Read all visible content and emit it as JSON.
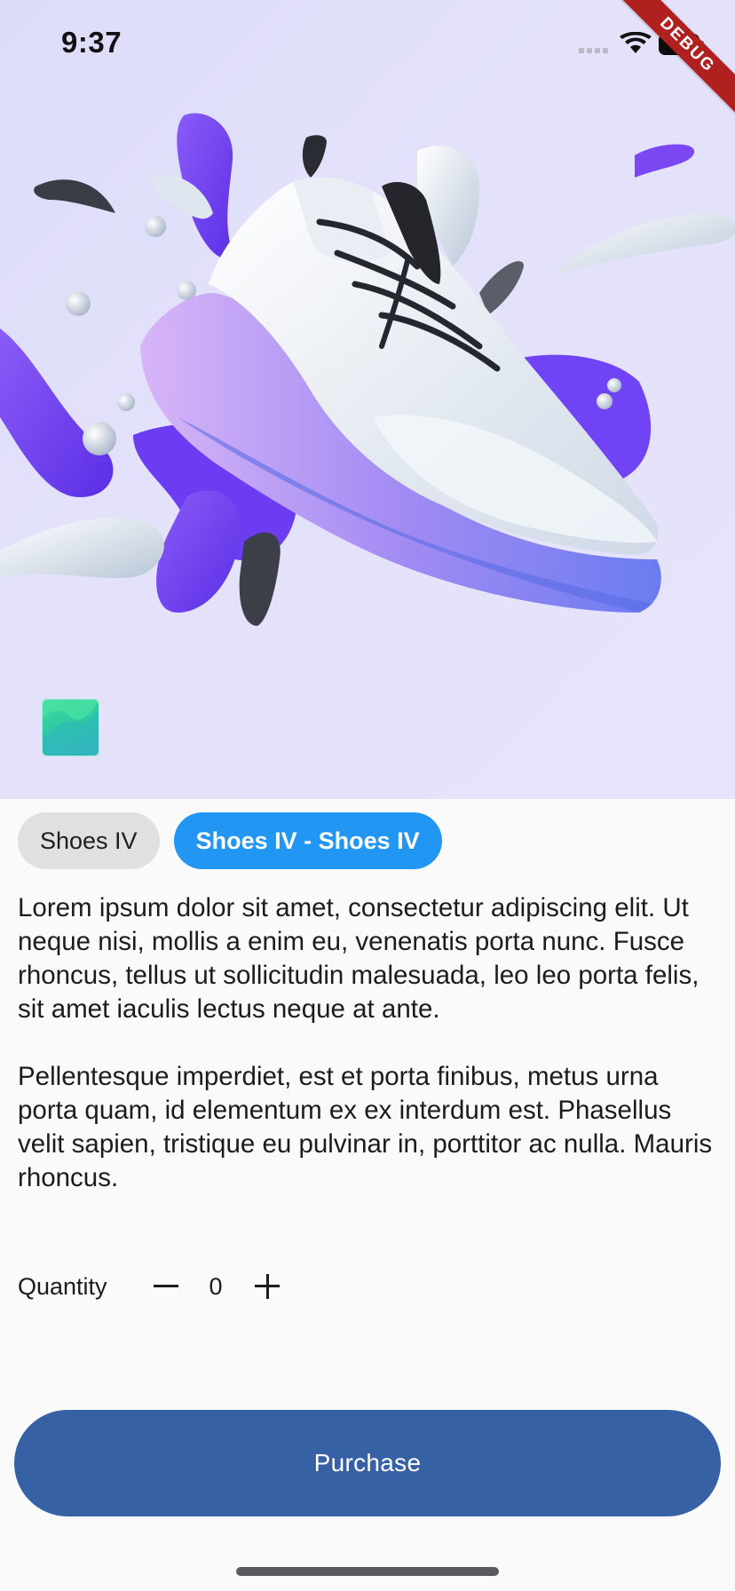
{
  "status_bar": {
    "time": "9:37",
    "icons": [
      "cellular-signal-icon",
      "wifi-icon",
      "battery-icon"
    ]
  },
  "debug_banner": {
    "label": "DEBUG"
  },
  "product": {
    "hero_image": "sneaker-with-paint-splashes",
    "thumbnail": "green-gradient-swatch",
    "chips": [
      {
        "label": "Shoes IV",
        "selected": false
      },
      {
        "label": "Shoes IV - Shoes IV",
        "selected": true
      }
    ],
    "description": [
      "Lorem ipsum dolor sit amet, consectetur adipiscing elit. Ut neque nisi, mollis a enim eu, venenatis porta nunc. Fusce rhoncus, tellus ut sollicitudin malesuada, leo leo porta felis, sit amet iaculis lectus neque at ante.",
      "Pellentesque imperdiet, est et porta finibus, metus urna porta quam, id elementum ex ex interdum est. Phasellus velit sapien, tristique eu pulvinar in, porttitor ac nulla. Mauris rhoncus."
    ]
  },
  "quantity": {
    "label": "Quantity",
    "value": "0",
    "decrement_icon": "minus-icon",
    "increment_icon": "plus-icon"
  },
  "purchase_button": {
    "label": "Purchase"
  },
  "colors": {
    "accent_blue": "#2196f3",
    "purchase_blue": "#3761a5",
    "hero_background": "#e1dffa",
    "splash_purple": "#6a3cf0",
    "chip_grey": "#e0e0e0"
  }
}
